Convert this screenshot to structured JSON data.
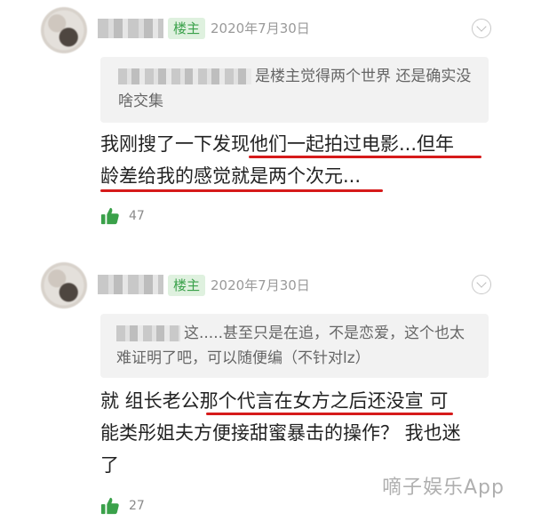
{
  "comments": [
    {
      "badge": "楼主",
      "date": "2020年7月30日",
      "quote": "是楼主觉得两个世界 还是确实没啥交集",
      "body_line1": "我刚搜了一下发现他们一起拍过电影...但年",
      "body_line2": "龄差给我的感觉就是两个次元...",
      "likes": "47"
    },
    {
      "badge": "楼主",
      "date": "2020年7月30日",
      "quote": "这.....甚至只是在追，不是恋爱，这个也太难证明了吧，可以随便编（不针对lz）",
      "body_line1": "就 组长老公那个代言在女方之后还没宣 可",
      "body_line2": "能类彤姐夫方便接甜蜜暴击的操作？ 我也迷",
      "body_line3": "了",
      "likes": "27"
    }
  ],
  "watermark": "嘀子娱乐App",
  "colors": {
    "accent_green": "#3aa14a",
    "badge_bg": "#dff1df",
    "underline_red": "#d61a1a"
  },
  "icons": {
    "like": "thumbs-up-icon",
    "more": "chevron-down-icon"
  }
}
